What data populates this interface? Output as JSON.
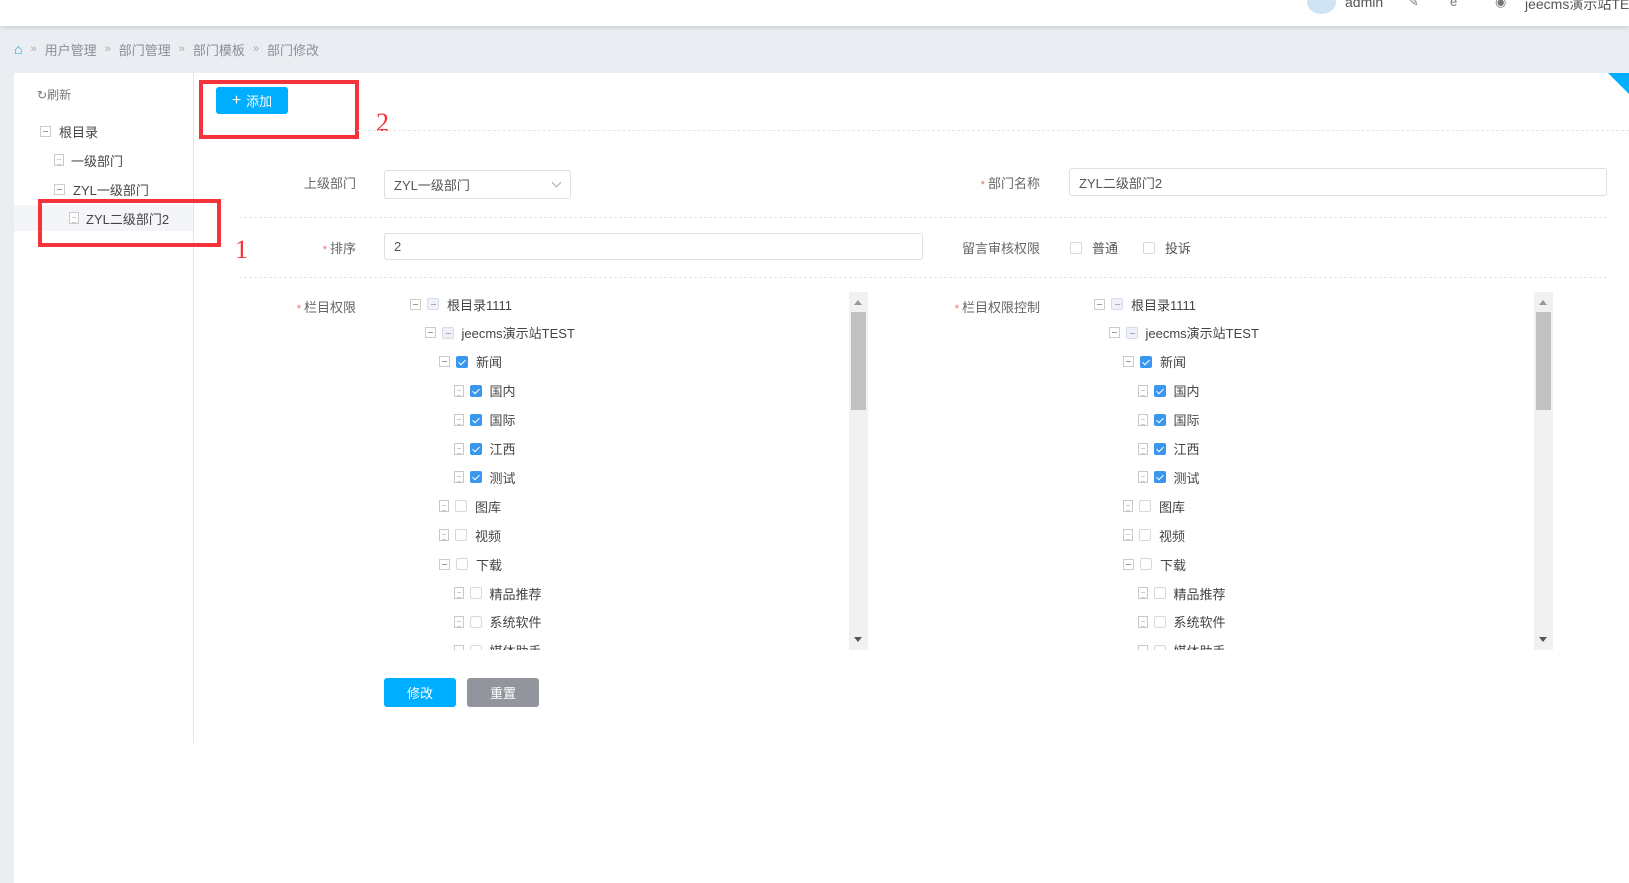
{
  "header": {
    "user": "admin",
    "site": "jeecms演示站TEST"
  },
  "breadcrumb": [
    "用户管理",
    "部门管理",
    "部门模板",
    "部门修改"
  ],
  "left_tree": {
    "refresh": "刷新",
    "items": [
      {
        "label": "根目录",
        "type": "folder",
        "level": 0
      },
      {
        "label": "一级部门",
        "type": "leaf",
        "level": 1
      },
      {
        "label": "ZYL一级部门",
        "type": "folder",
        "level": 1
      },
      {
        "label": "ZYL二级部门2",
        "type": "leaf",
        "level": 2,
        "selected": true
      }
    ]
  },
  "annotations": {
    "box1": "1",
    "box2": "2"
  },
  "toolbar": {
    "add": "添加"
  },
  "form": {
    "parent_label": "上级部门",
    "parent_value": "ZYL一级部门",
    "name_label": "部门名称",
    "name_value": "ZYL二级部门2",
    "sort_label": "排序",
    "sort_value": "2",
    "review_label": "留言审核权限",
    "review_options": [
      {
        "label": "普通",
        "checked": false
      },
      {
        "label": "投诉",
        "checked": false
      }
    ],
    "column_label": "栏目权限",
    "column_control_label": "栏目权限控制",
    "required_mark": "*",
    "submit": "修改",
    "reset": "重置"
  },
  "column_tree": [
    {
      "label": "根目录1111",
      "level": 0,
      "type": "folder",
      "state": "part"
    },
    {
      "label": "jeecms演示站TEST",
      "level": 1,
      "type": "folder",
      "state": "part"
    },
    {
      "label": "新闻",
      "level": 2,
      "type": "folder",
      "state": "on"
    },
    {
      "label": "国内",
      "level": 3,
      "type": "leaf",
      "state": "on"
    },
    {
      "label": "国际",
      "level": 3,
      "type": "leaf",
      "state": "on"
    },
    {
      "label": "江西",
      "level": 3,
      "type": "leaf",
      "state": "on"
    },
    {
      "label": "测试",
      "level": 3,
      "type": "leaf",
      "state": "on"
    },
    {
      "label": "图库",
      "level": 2,
      "type": "leaf",
      "state": "off"
    },
    {
      "label": "视频",
      "level": 2,
      "type": "leaf",
      "state": "off"
    },
    {
      "label": "下载",
      "level": 2,
      "type": "folder",
      "state": "off"
    },
    {
      "label": "精品推荐",
      "level": 3,
      "type": "leaf",
      "state": "off"
    },
    {
      "label": "系统软件",
      "level": 3,
      "type": "leaf",
      "state": "off"
    },
    {
      "label": "媒体助手",
      "level": 3,
      "type": "leaf",
      "state": "off"
    }
  ],
  "colors": {
    "primary": "#00aeff",
    "gray_button": "#92959b",
    "annotation": "#f5333a",
    "check": "#3a97f0"
  }
}
